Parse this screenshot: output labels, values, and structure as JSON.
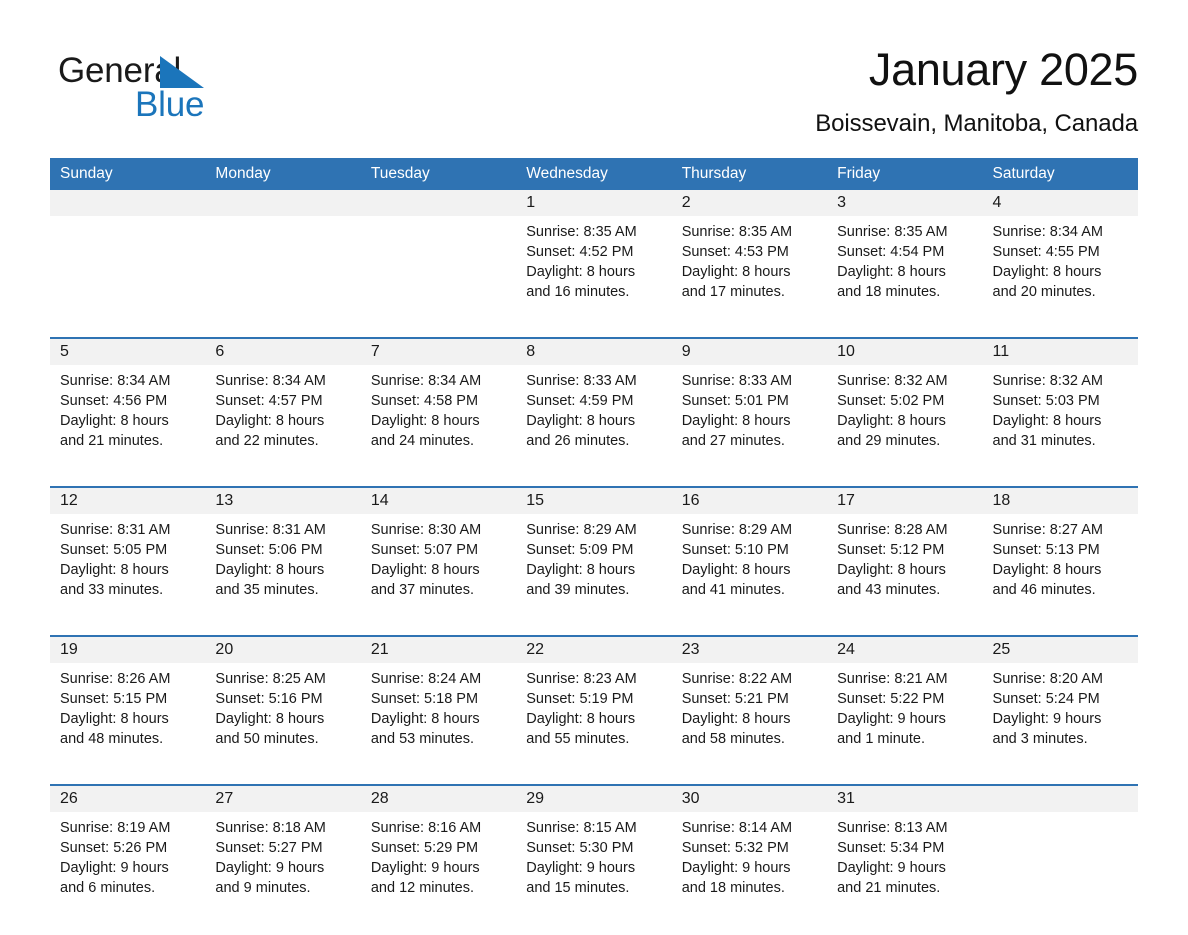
{
  "brand": {
    "name_part1": "General",
    "name_part2": "Blue",
    "triangle_color": "#1b75bb",
    "text_color": "#1a1a1a"
  },
  "header": {
    "title": "January 2025",
    "subtitle": "Boissevain, Manitoba, Canada"
  },
  "theme": {
    "header_blue": "#2f73b3",
    "daynum_band": "#f2f2f2",
    "separator_blue": "#2f73b3",
    "page_background": "#ffffff"
  },
  "weekday_headers": [
    "Sunday",
    "Monday",
    "Tuesday",
    "Wednesday",
    "Thursday",
    "Friday",
    "Saturday"
  ],
  "weeks": [
    [
      {
        "day": "",
        "sunrise": "",
        "sunset": "",
        "daylight1": "",
        "daylight2": ""
      },
      {
        "day": "",
        "sunrise": "",
        "sunset": "",
        "daylight1": "",
        "daylight2": ""
      },
      {
        "day": "",
        "sunrise": "",
        "sunset": "",
        "daylight1": "",
        "daylight2": ""
      },
      {
        "day": "1",
        "sunrise": "Sunrise: 8:35 AM",
        "sunset": "Sunset: 4:52 PM",
        "daylight1": "Daylight: 8 hours",
        "daylight2": "and 16 minutes."
      },
      {
        "day": "2",
        "sunrise": "Sunrise: 8:35 AM",
        "sunset": "Sunset: 4:53 PM",
        "daylight1": "Daylight: 8 hours",
        "daylight2": "and 17 minutes."
      },
      {
        "day": "3",
        "sunrise": "Sunrise: 8:35 AM",
        "sunset": "Sunset: 4:54 PM",
        "daylight1": "Daylight: 8 hours",
        "daylight2": "and 18 minutes."
      },
      {
        "day": "4",
        "sunrise": "Sunrise: 8:34 AM",
        "sunset": "Sunset: 4:55 PM",
        "daylight1": "Daylight: 8 hours",
        "daylight2": "and 20 minutes."
      }
    ],
    [
      {
        "day": "5",
        "sunrise": "Sunrise: 8:34 AM",
        "sunset": "Sunset: 4:56 PM",
        "daylight1": "Daylight: 8 hours",
        "daylight2": "and 21 minutes."
      },
      {
        "day": "6",
        "sunrise": "Sunrise: 8:34 AM",
        "sunset": "Sunset: 4:57 PM",
        "daylight1": "Daylight: 8 hours",
        "daylight2": "and 22 minutes."
      },
      {
        "day": "7",
        "sunrise": "Sunrise: 8:34 AM",
        "sunset": "Sunset: 4:58 PM",
        "daylight1": "Daylight: 8 hours",
        "daylight2": "and 24 minutes."
      },
      {
        "day": "8",
        "sunrise": "Sunrise: 8:33 AM",
        "sunset": "Sunset: 4:59 PM",
        "daylight1": "Daylight: 8 hours",
        "daylight2": "and 26 minutes."
      },
      {
        "day": "9",
        "sunrise": "Sunrise: 8:33 AM",
        "sunset": "Sunset: 5:01 PM",
        "daylight1": "Daylight: 8 hours",
        "daylight2": "and 27 minutes."
      },
      {
        "day": "10",
        "sunrise": "Sunrise: 8:32 AM",
        "sunset": "Sunset: 5:02 PM",
        "daylight1": "Daylight: 8 hours",
        "daylight2": "and 29 minutes."
      },
      {
        "day": "11",
        "sunrise": "Sunrise: 8:32 AM",
        "sunset": "Sunset: 5:03 PM",
        "daylight1": "Daylight: 8 hours",
        "daylight2": "and 31 minutes."
      }
    ],
    [
      {
        "day": "12",
        "sunrise": "Sunrise: 8:31 AM",
        "sunset": "Sunset: 5:05 PM",
        "daylight1": "Daylight: 8 hours",
        "daylight2": "and 33 minutes."
      },
      {
        "day": "13",
        "sunrise": "Sunrise: 8:31 AM",
        "sunset": "Sunset: 5:06 PM",
        "daylight1": "Daylight: 8 hours",
        "daylight2": "and 35 minutes."
      },
      {
        "day": "14",
        "sunrise": "Sunrise: 8:30 AM",
        "sunset": "Sunset: 5:07 PM",
        "daylight1": "Daylight: 8 hours",
        "daylight2": "and 37 minutes."
      },
      {
        "day": "15",
        "sunrise": "Sunrise: 8:29 AM",
        "sunset": "Sunset: 5:09 PM",
        "daylight1": "Daylight: 8 hours",
        "daylight2": "and 39 minutes."
      },
      {
        "day": "16",
        "sunrise": "Sunrise: 8:29 AM",
        "sunset": "Sunset: 5:10 PM",
        "daylight1": "Daylight: 8 hours",
        "daylight2": "and 41 minutes."
      },
      {
        "day": "17",
        "sunrise": "Sunrise: 8:28 AM",
        "sunset": "Sunset: 5:12 PM",
        "daylight1": "Daylight: 8 hours",
        "daylight2": "and 43 minutes."
      },
      {
        "day": "18",
        "sunrise": "Sunrise: 8:27 AM",
        "sunset": "Sunset: 5:13 PM",
        "daylight1": "Daylight: 8 hours",
        "daylight2": "and 46 minutes."
      }
    ],
    [
      {
        "day": "19",
        "sunrise": "Sunrise: 8:26 AM",
        "sunset": "Sunset: 5:15 PM",
        "daylight1": "Daylight: 8 hours",
        "daylight2": "and 48 minutes."
      },
      {
        "day": "20",
        "sunrise": "Sunrise: 8:25 AM",
        "sunset": "Sunset: 5:16 PM",
        "daylight1": "Daylight: 8 hours",
        "daylight2": "and 50 minutes."
      },
      {
        "day": "21",
        "sunrise": "Sunrise: 8:24 AM",
        "sunset": "Sunset: 5:18 PM",
        "daylight1": "Daylight: 8 hours",
        "daylight2": "and 53 minutes."
      },
      {
        "day": "22",
        "sunrise": "Sunrise: 8:23 AM",
        "sunset": "Sunset: 5:19 PM",
        "daylight1": "Daylight: 8 hours",
        "daylight2": "and 55 minutes."
      },
      {
        "day": "23",
        "sunrise": "Sunrise: 8:22 AM",
        "sunset": "Sunset: 5:21 PM",
        "daylight1": "Daylight: 8 hours",
        "daylight2": "and 58 minutes."
      },
      {
        "day": "24",
        "sunrise": "Sunrise: 8:21 AM",
        "sunset": "Sunset: 5:22 PM",
        "daylight1": "Daylight: 9 hours",
        "daylight2": "and 1 minute."
      },
      {
        "day": "25",
        "sunrise": "Sunrise: 8:20 AM",
        "sunset": "Sunset: 5:24 PM",
        "daylight1": "Daylight: 9 hours",
        "daylight2": "and 3 minutes."
      }
    ],
    [
      {
        "day": "26",
        "sunrise": "Sunrise: 8:19 AM",
        "sunset": "Sunset: 5:26 PM",
        "daylight1": "Daylight: 9 hours",
        "daylight2": "and 6 minutes."
      },
      {
        "day": "27",
        "sunrise": "Sunrise: 8:18 AM",
        "sunset": "Sunset: 5:27 PM",
        "daylight1": "Daylight: 9 hours",
        "daylight2": "and 9 minutes."
      },
      {
        "day": "28",
        "sunrise": "Sunrise: 8:16 AM",
        "sunset": "Sunset: 5:29 PM",
        "daylight1": "Daylight: 9 hours",
        "daylight2": "and 12 minutes."
      },
      {
        "day": "29",
        "sunrise": "Sunrise: 8:15 AM",
        "sunset": "Sunset: 5:30 PM",
        "daylight1": "Daylight: 9 hours",
        "daylight2": "and 15 minutes."
      },
      {
        "day": "30",
        "sunrise": "Sunrise: 8:14 AM",
        "sunset": "Sunset: 5:32 PM",
        "daylight1": "Daylight: 9 hours",
        "daylight2": "and 18 minutes."
      },
      {
        "day": "31",
        "sunrise": "Sunrise: 8:13 AM",
        "sunset": "Sunset: 5:34 PM",
        "daylight1": "Daylight: 9 hours",
        "daylight2": "and 21 minutes."
      },
      {
        "day": "",
        "sunrise": "",
        "sunset": "",
        "daylight1": "",
        "daylight2": ""
      }
    ]
  ]
}
